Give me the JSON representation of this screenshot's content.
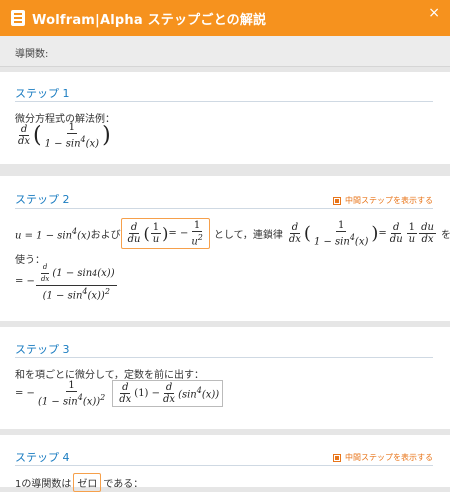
{
  "window": {
    "title": "Wolfram|Alpha ステップごとの解説",
    "close_label": "×"
  },
  "header": {
    "label": "導関数:"
  },
  "steps": [
    {
      "title": "ステップ 1",
      "text": "微分方程式の解法例："
    },
    {
      "title": "ステップ 2",
      "show_label": "中間ステップを表示する",
      "text_and": "および",
      "text_as": "として，連鎖律",
      "text_wo": "を",
      "text_use": "使う："
    },
    {
      "title": "ステップ 3",
      "text": "和を項ごとに微分して，定数を前に出す："
    },
    {
      "title": "ステップ 4",
      "show_label": "中間ステップを表示する",
      "text": "1の導関数は",
      "highlight": "ゼロ",
      "text_end": "である："
    }
  ],
  "colors": {
    "accent": "#f6921e",
    "step_title": "#1a7cc1",
    "link": "#e8751a"
  }
}
